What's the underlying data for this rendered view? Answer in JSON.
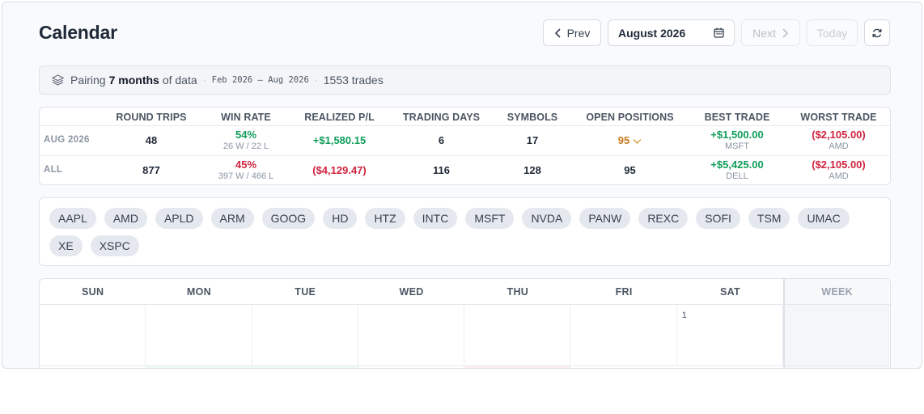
{
  "header": {
    "title": "Calendar",
    "prev_label": "Prev",
    "month_label": "August 2026",
    "next_label": "Next",
    "today_label": "Today"
  },
  "pairing": {
    "prefix": "Pairing",
    "months": "7 months",
    "suffix": "of data",
    "range": "Feb 2026 – Aug 2026",
    "trades": "1553 trades"
  },
  "stats": {
    "columns": [
      "ROUND TRIPS",
      "WIN RATE",
      "REALIZED P/L",
      "TRADING DAYS",
      "SYMBOLS",
      "OPEN POSITIONS",
      "BEST TRADE",
      "WORST TRADE"
    ],
    "rows": [
      {
        "label": "AUG 2026",
        "round_trips": "48",
        "win_rate": "54%",
        "win_rate_sub": "26 W / 22 L",
        "realized_pl": "+$1,580.15",
        "trading_days": "6",
        "symbols": "17",
        "open_positions": "95",
        "best_trade": "+$1,500.00",
        "best_trade_sym": "MSFT",
        "worst_trade": "($2,105.00)",
        "worst_trade_sym": "AMD"
      },
      {
        "label": "ALL",
        "round_trips": "877",
        "win_rate": "45%",
        "win_rate_sub": "397 W / 466 L",
        "realized_pl": "($4,129.47)",
        "trading_days": "116",
        "symbols": "128",
        "open_positions": "95",
        "best_trade": "+$5,425.00",
        "best_trade_sym": "DELL",
        "worst_trade": "($2,105.00)",
        "worst_trade_sym": "AMD"
      }
    ]
  },
  "symbols": [
    "AAPL",
    "AMD",
    "APLD",
    "ARM",
    "GOOG",
    "HD",
    "HTZ",
    "INTC",
    "MSFT",
    "NVDA",
    "PANW",
    "REXC",
    "SOFI",
    "TSM",
    "UMAC",
    "XE",
    "XSPC"
  ],
  "calendar": {
    "days": [
      "SUN",
      "MON",
      "TUE",
      "WED",
      "THU",
      "FRI",
      "SAT"
    ],
    "week_label": "WEEK",
    "first_row": [
      "",
      "",
      "",
      "",
      "",
      "",
      "1"
    ]
  },
  "colors": {
    "positive": "#0f9d58",
    "negative": "#d0243f",
    "amber": "#c7771a"
  }
}
